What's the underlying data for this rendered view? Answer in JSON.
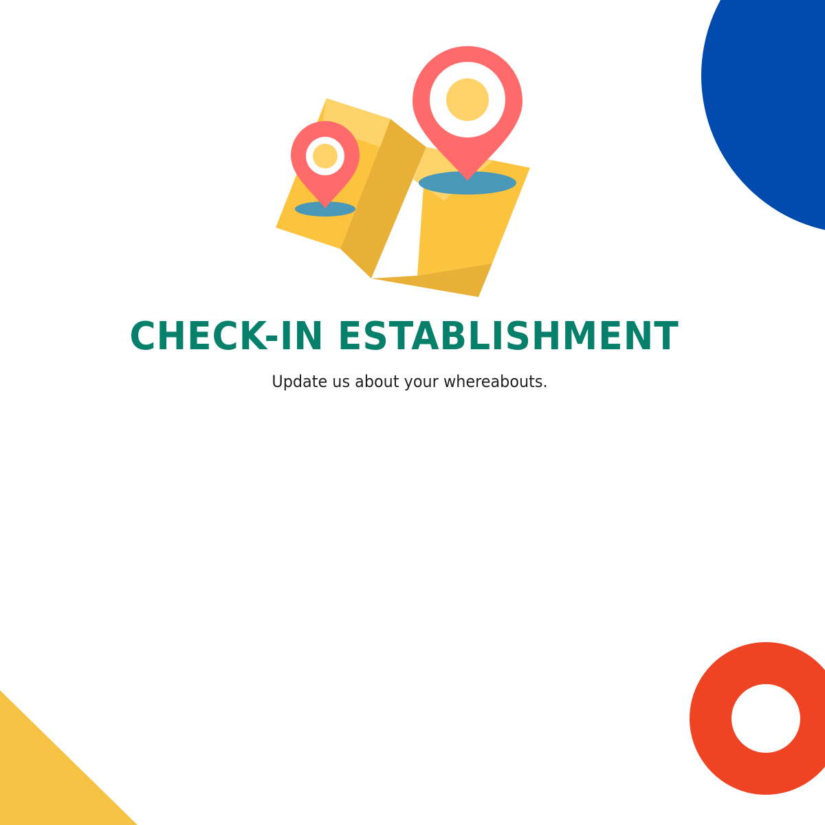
{
  "colors": {
    "background": "#ffffff",
    "title": "#06806b",
    "subtitle": "#1f1f1f",
    "blue_shape": "#0049ad",
    "red_ring": "#ee4423",
    "yellow_triangle": "#f6c243"
  },
  "illustration": {
    "icon": "folded-map-with-location-pins-icon"
  },
  "header": {
    "title": "CHECK-IN ESTABLISHMENT",
    "subtitle": "Update us about your whereabouts."
  }
}
